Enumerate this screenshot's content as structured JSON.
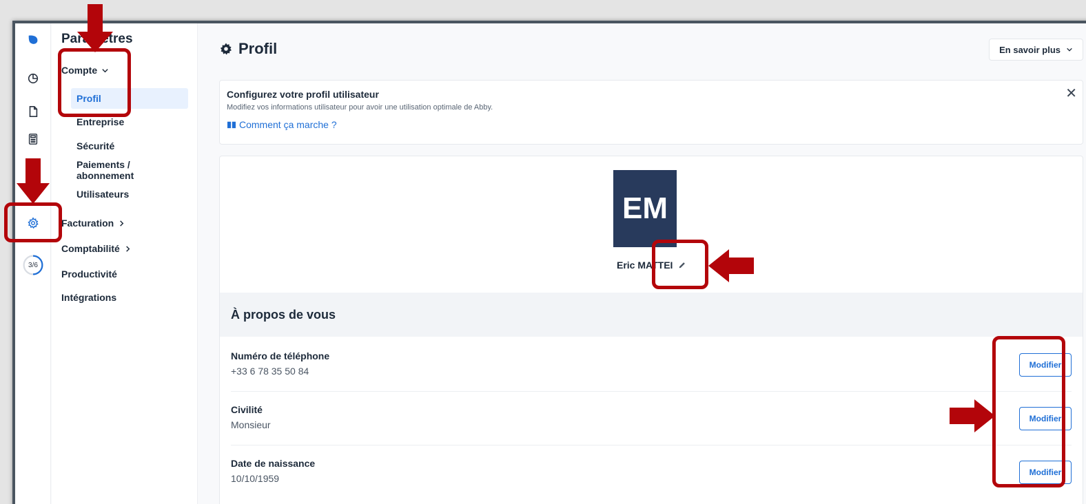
{
  "rail": {
    "items": [
      {
        "name": "logo",
        "icon": "leaf-logo-icon"
      },
      {
        "name": "dashboard",
        "icon": "pie-chart-icon"
      },
      {
        "name": "documents",
        "icon": "file-icon"
      },
      {
        "name": "accounting",
        "icon": "calculator-icon"
      },
      {
        "name": "settings",
        "icon": "gear-icon"
      }
    ],
    "progress_label": "3/6"
  },
  "subnav": {
    "title": "Paramètres",
    "groups": [
      {
        "label": "Compte",
        "items": [
          "Profil",
          "Entreprise",
          "Sécurité",
          "Paiements / abonnement",
          "Utilisateurs"
        ]
      },
      {
        "label": "Facturation"
      },
      {
        "label": "Comptabilité"
      },
      {
        "label": "Productivité"
      },
      {
        "label": "Intégrations"
      }
    ],
    "active_item": "Profil"
  },
  "header": {
    "title": "Profil",
    "learn_more": "En savoir plus"
  },
  "banner": {
    "title": "Configurez votre profil utilisateur",
    "description": "Modifiez vos informations utilisateur pour avoir une utilisation optimale de Abby.",
    "link": "Comment ça marche ?"
  },
  "profile": {
    "initials": "EM",
    "name": "Eric MATTEI",
    "section_title": "À propos de vous",
    "fields": [
      {
        "label": "Numéro de téléphone",
        "value": "+33 6 78 35 50 84",
        "action": "Modifier"
      },
      {
        "label": "Civilité",
        "value": "Monsieur",
        "action": "Modifier"
      },
      {
        "label": "Date de naissance",
        "value": "10/10/1959",
        "action": "Modifier"
      }
    ]
  },
  "colors": {
    "accent": "#1f6fd6",
    "annotation": "#b3050a",
    "avatar_bg": "#283a5c"
  }
}
